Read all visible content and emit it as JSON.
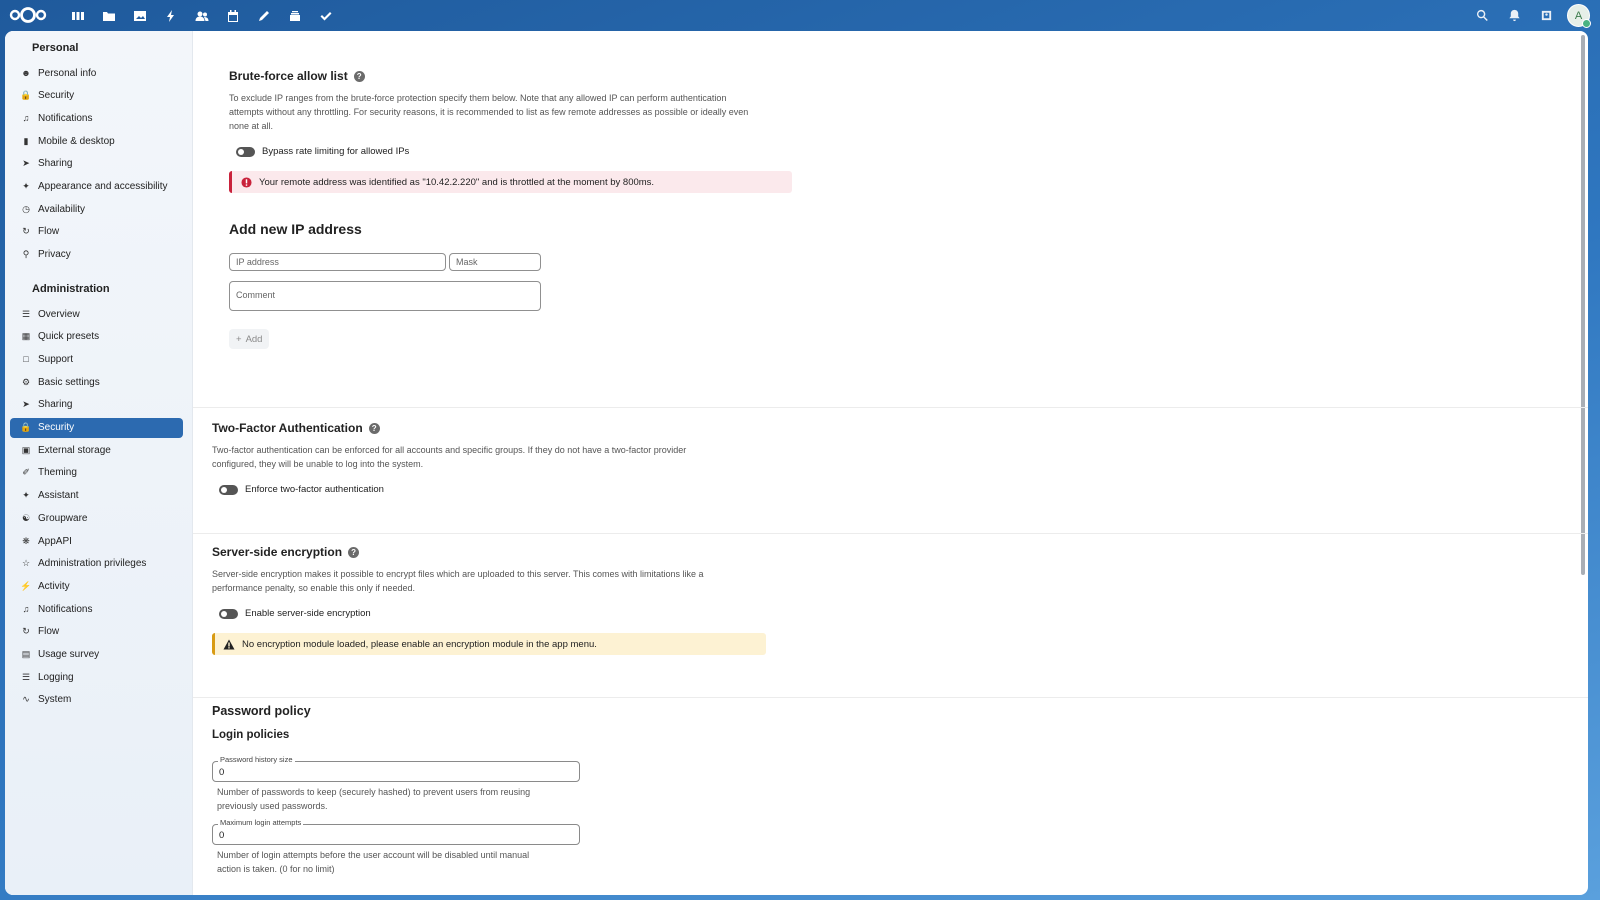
{
  "header": {
    "apps": [
      "dashboard-icon",
      "files-icon",
      "photos-icon",
      "activity-icon",
      "contacts-icon",
      "calendar-icon",
      "notes-icon",
      "deck-icon",
      "tasks-icon"
    ],
    "right": [
      "search-icon",
      "notifications-icon",
      "contacts-menu-icon"
    ],
    "avatar_letter": "A"
  },
  "sidebar": {
    "personal_title": "Personal",
    "personal": [
      {
        "label": "Personal info",
        "icon": "user-icon"
      },
      {
        "label": "Security",
        "icon": "lock-icon"
      },
      {
        "label": "Notifications",
        "icon": "bell-icon"
      },
      {
        "label": "Mobile & desktop",
        "icon": "phone-icon"
      },
      {
        "label": "Sharing",
        "icon": "share-icon"
      },
      {
        "label": "Appearance and accessibility",
        "icon": "accessibility-icon"
      },
      {
        "label": "Availability",
        "icon": "clock-icon"
      },
      {
        "label": "Flow",
        "icon": "flow-icon"
      },
      {
        "label": "Privacy",
        "icon": "key-icon"
      }
    ],
    "admin_title": "Administration",
    "admin": [
      {
        "label": "Overview",
        "icon": "tune-icon"
      },
      {
        "label": "Quick presets",
        "icon": "presets-icon"
      },
      {
        "label": "Support",
        "icon": "support-icon"
      },
      {
        "label": "Basic settings",
        "icon": "gear-icon"
      },
      {
        "label": "Sharing",
        "icon": "share-icon"
      },
      {
        "label": "Security",
        "icon": "lock-icon"
      },
      {
        "label": "External storage",
        "icon": "storage-icon"
      },
      {
        "label": "Theming",
        "icon": "paint-icon"
      },
      {
        "label": "Assistant",
        "icon": "sparkle-icon"
      },
      {
        "label": "Groupware",
        "icon": "group-icon"
      },
      {
        "label": "AppAPI",
        "icon": "api-icon"
      },
      {
        "label": "Administration privileges",
        "icon": "admin-icon"
      },
      {
        "label": "Activity",
        "icon": "activity-icon"
      },
      {
        "label": "Notifications",
        "icon": "bell-icon"
      },
      {
        "label": "Flow",
        "icon": "flow-icon"
      },
      {
        "label": "Usage survey",
        "icon": "chart-icon"
      },
      {
        "label": "Logging",
        "icon": "list-icon"
      },
      {
        "label": "System",
        "icon": "pulse-icon"
      }
    ],
    "active_admin_index": 5
  },
  "bruteforce": {
    "title": "Brute-force allow list",
    "desc1": "To exclude IP ranges from the brute-force protection specify them below. Note that any allowed IP can perform authentication",
    "desc2": "attempts without any throttling. For security reasons, it is recommended to list as few remote addresses as possible or ideally even",
    "desc3": "none at all.",
    "toggle_label": "Bypass rate limiting for allowed IPs",
    "error": "Your remote address was identified as \"10.42.2.220\" and is throttled at the moment by 800ms.",
    "add_title": "Add new IP address",
    "ip_placeholder": "IP address",
    "mask_placeholder": "Mask",
    "comment_placeholder": "Comment",
    "add_label": "Add"
  },
  "twofactor": {
    "title": "Two-Factor Authentication",
    "desc1": "Two-factor authentication can be enforced for all accounts and specific groups. If they do not have a two-factor provider",
    "desc2": "configured, they will be unable to log into the system.",
    "toggle_label": "Enforce two-factor authentication"
  },
  "sse": {
    "title": "Server-side encryption",
    "desc1": "Server-side encryption makes it possible to encrypt files which are uploaded to this server. This comes with limitations like a",
    "desc2": "performance penalty, so enable this only if needed.",
    "toggle_label": "Enable server-side encryption",
    "warning": "No encryption module loaded, please enable an encryption module in the app menu."
  },
  "password": {
    "title": "Password policy",
    "subtitle": "Login policies",
    "history_label": "Password history size",
    "history_value": "0",
    "history_help1": "Number of passwords to keep (securely hashed) to prevent users from reusing",
    "history_help2": "previously used passwords.",
    "attempts_label": "Maximum login attempts",
    "attempts_value": "0",
    "attempts_help1": "Number of login attempts before the user account will be disabled until manual",
    "attempts_help2": "action is taken. (0 for no limit)"
  }
}
